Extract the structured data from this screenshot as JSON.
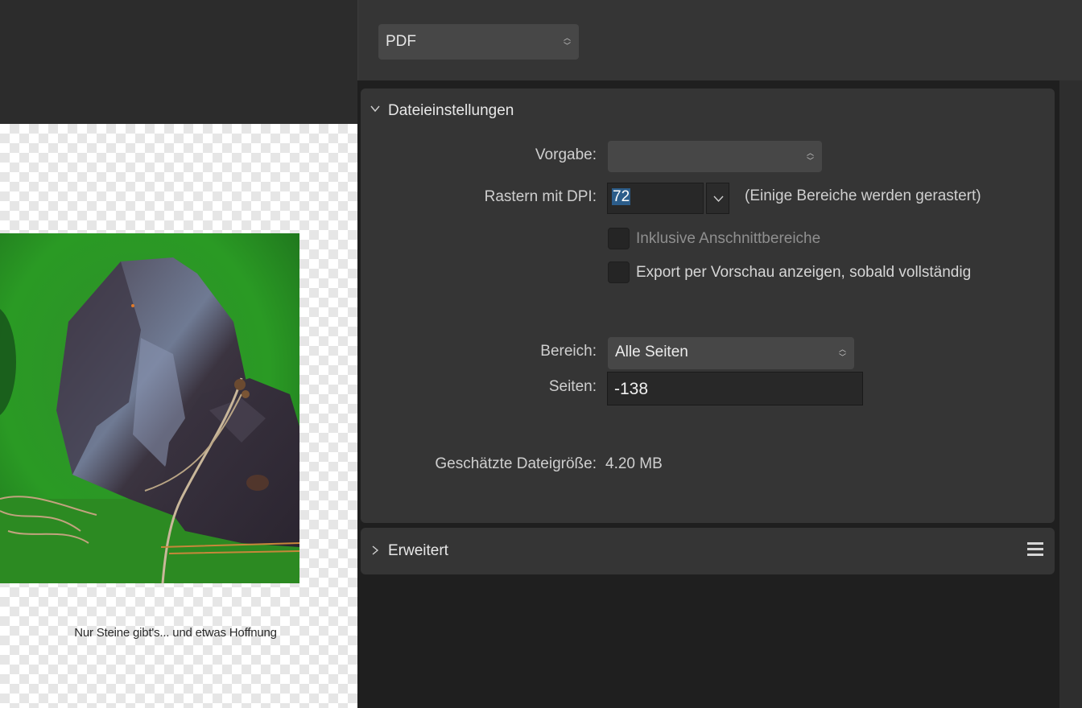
{
  "preview": {
    "caption": "Nur Steine gibt's... und etwas Hoffnung"
  },
  "export": {
    "format": "PDF"
  },
  "file_settings": {
    "title": "Dateieinstellungen",
    "preset_label": "Vorgabe:",
    "preset_value": "",
    "dpi_label": "Rastern mit DPI:",
    "dpi_value": "72",
    "dpi_note": "(Einige Bereiche werden gerastert)",
    "bleed_label": "Inklusive Anschnittbereiche",
    "bleed_checked": false,
    "preview_label": "Export per Vorschau anzeigen, sobald vollständig",
    "preview_checked": false,
    "range_label": "Bereich:",
    "range_value": "Alle Seiten",
    "pages_label": "Seiten:",
    "pages_value": "-138",
    "filesize_label": "Geschätzte Dateigröße:",
    "filesize_value": "4.20 MB"
  },
  "advanced": {
    "title": "Erweitert"
  },
  "colors": {
    "panel": "#353535",
    "selection": "#2c5d8a",
    "photo_green": "#2f9a2a"
  }
}
